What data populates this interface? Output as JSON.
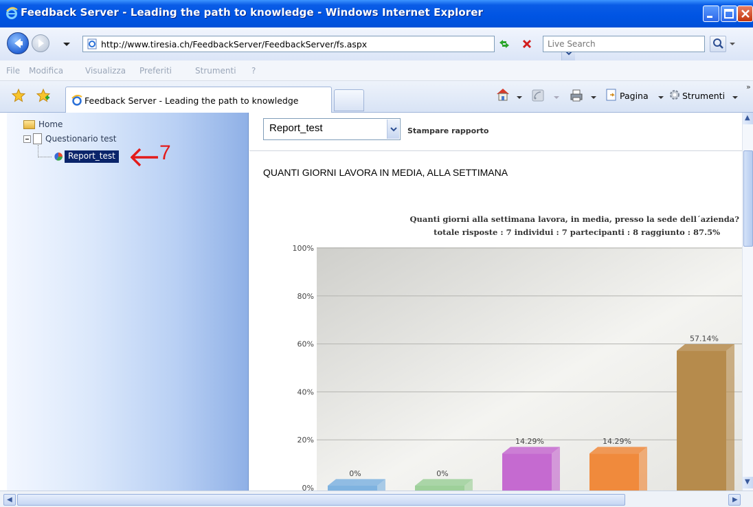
{
  "window": {
    "title": "Feedback Server - Leading the path to knowledge - Windows Internet Explorer"
  },
  "address_bar": {
    "url": "http://www.tiresia.ch/FeedbackServer/FeedbackServer/fs.aspx",
    "search_placeholder": "Live Search"
  },
  "menu": {
    "items": [
      "File",
      "Modifica",
      "Visualizza",
      "Preferiti",
      "Strumenti",
      "?"
    ]
  },
  "tabs": {
    "active_label": "Feedback Server - Leading the path to knowledge"
  },
  "command_bar": {
    "page_label": "Pagina",
    "tools_label": "Strumenti"
  },
  "tree": {
    "home": "Home",
    "questionnaire": "Questionario test",
    "report": "Report_test",
    "annotation_number": "7"
  },
  "report": {
    "selected": "Report_test",
    "print_link": "Stampare rapporto",
    "section_title": "QUANTI GIORNI LAVORA IN MEDIA, ALLA SETTIMANA"
  },
  "chart_data": {
    "type": "bar",
    "title": "Quanti giorni alla settimana lavora, in media, presso la sede dell´azienda?",
    "subtitle": "totale risposte : 7 individui : 7 partecipanti : 8 raggiunto : 87.5%",
    "y_ticks": [
      "100%",
      "80%",
      "60%",
      "40%",
      "20%",
      "0%"
    ],
    "ylim": [
      0,
      100
    ],
    "values": [
      0,
      0,
      14.29,
      14.29,
      57.14
    ],
    "data_labels": [
      "0%",
      "0%",
      "14.29%",
      "14.29%",
      "57.14%"
    ],
    "colors": [
      "#7fb3e0",
      "#9ed09a",
      "#c56ad0",
      "#f08a3c",
      "#b68b4c"
    ],
    "grid": true
  }
}
